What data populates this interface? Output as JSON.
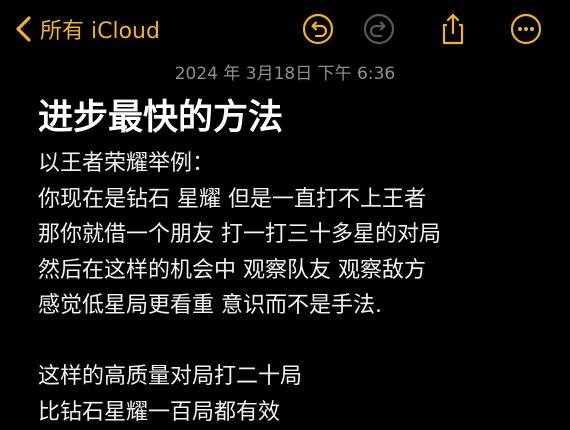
{
  "nav": {
    "back_label": "所有 iCloud"
  },
  "toolbar": {
    "icons": [
      "undo-icon",
      "redo-icon",
      "share-icon",
      "more-icon"
    ],
    "accent_color": "#f5b21a",
    "disabled_color": "#5a5a5e"
  },
  "note": {
    "date": "2024 年 3月18日 下午 6:36",
    "title": "进步最快的方法",
    "lines": [
      "以王者荣耀举例：",
      "你现在是钻石 星耀 但是一直打不上王者",
      "那你就借一个朋友 打一打三十多星的对局",
      "然后在这样的机会中 观察队友 观察敌方",
      "感觉低星局更看重 意识而不是手法.",
      "",
      "这样的高质量对局打二十局",
      "比钻石星耀一百局都有效"
    ]
  }
}
